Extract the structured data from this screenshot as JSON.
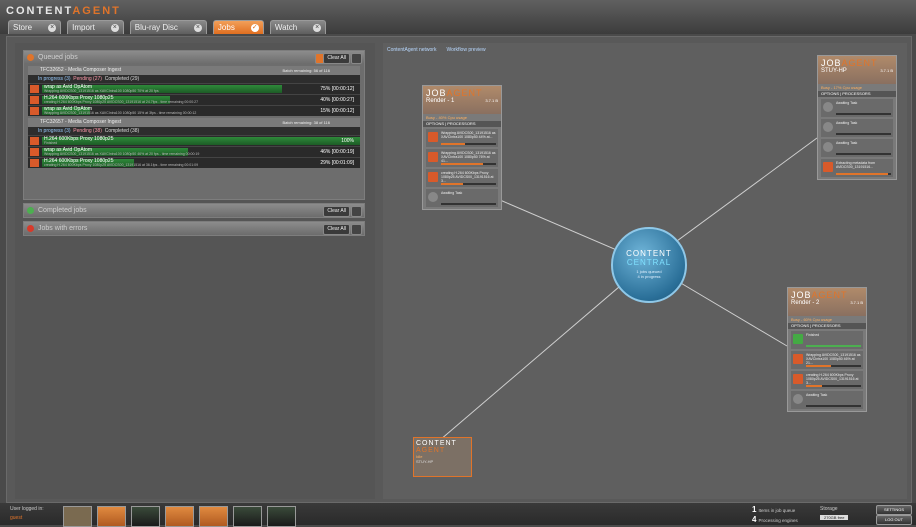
{
  "app": {
    "logo_white": "CONTENT",
    "logo_orange": "AGENT"
  },
  "tabs": [
    {
      "label": "Store"
    },
    {
      "label": "Import"
    },
    {
      "label": "Blu-ray Disc"
    },
    {
      "label": "Jobs"
    },
    {
      "label": "Watch"
    }
  ],
  "queued": {
    "title": "Queued jobs",
    "clear_label": "Clear All",
    "groups": [
      {
        "title": "TFC32652 - Media Composer Ingest",
        "sub": "Submitted by ContentAgent 'STUY-HP' at 14:49:46 on 17/05/2018",
        "remaining": "Batch remaining: 56 of 116",
        "in_progress": "In progress (3)",
        "pending": "Pending (27)",
        "completed": "Completed (29)",
        "rows": [
          {
            "title": "wrap as Avid OpAtom",
            "detail": "Wrapping AVIDCS00_13191516 as XAVCIntra100 1080p50 70% at 20 fps",
            "pct": "75% [00:00:12]",
            "progress": 0.75
          },
          {
            "title": "H.264 600Kbps Proxy 1080p25",
            "detail": "creating H.264 600Kbps Proxy 1080p25 AVIDCS00_13191516 at 24.7fps - time remaining 00:00:27",
            "pct": "40% [00:00:27]",
            "progress": 0.4
          },
          {
            "title": "wrap as Avid OpAtom",
            "detail": "Wrapping AVIDCS00_13191516 as XAVCIntra100 1080p50 15% at 3fps - time remaining 00:00:12",
            "pct": "15% [00:00:12]",
            "progress": 0.15
          }
        ]
      },
      {
        "title": "TFC32657 - Media Composer Ingest",
        "sub": "Submitted by ContentAgent 'STUY-HP' at 15:49:53 on 17/05/2018",
        "remaining": "Batch remaining: 38 of 116",
        "in_progress": "In progress (3)",
        "pending": "Pending (38)",
        "completed": "Completed (38)",
        "rows": [
          {
            "title": "H.264 600Kbps Proxy 1080p25",
            "detail": "Finished",
            "pct": "100%",
            "progress": 1.0
          },
          {
            "title": "wrap as Avid OpAtom",
            "detail": "Wrapping AVIDCS00_13191516 as XAVCIntra100 1080p50 46% at 20 fps - time remaining 00:00:19",
            "pct": "46% [00:00:19]",
            "progress": 0.46
          },
          {
            "title": "H.264 600Kbps Proxy 1080p25",
            "detail": "creating H.264 600Kbps Proxy 1080p25 AVIDCS00_13191516 at 36.1fps - time remaining 00:01:09",
            "pct": "29% [00:01:09]",
            "progress": 0.29
          }
        ]
      }
    ]
  },
  "completed_jobs": {
    "title": "Completed jobs",
    "clear_label": "Clear All"
  },
  "errored_jobs": {
    "title": "Jobs with errors",
    "clear_label": "Clear All"
  },
  "network": {
    "tab1": "ContentAgent network",
    "tab2": "Workflow preview"
  },
  "agents": [
    {
      "name": "Render - 1",
      "version": "3.7.1 B",
      "status": "Busy - 40% Cpu usage",
      "priority": "Priority",
      "processors_label": "OPTIONS | PROCESSORS",
      "slots": [
        {
          "text": "Wrapping AVIDCS00_13191516 as XAVCIntra100 1080p50 44% at...",
          "progress": 0.44
        },
        {
          "text": "Wrapping AVIDCS00_13191516 as XAVCIntra100 1080p50 76% at 41...",
          "progress": 0.76
        },
        {
          "text": "creating H.264 600Kbps Proxy 1080p25 AVIDCS00_13191516 at 3...",
          "progress": 0.4
        },
        {
          "text": "Awaiting Task",
          "progress": 0
        }
      ]
    },
    {
      "name": "STUY-HP",
      "version": "3.7.1 B",
      "status": "Busy - 17% Cpu usage",
      "priority": "Priority",
      "processors_label": "OPTIONS | PROCESSORS",
      "slots": [
        {
          "text": "Awaiting Task",
          "progress": 0
        },
        {
          "text": "Awaiting Task",
          "progress": 0
        },
        {
          "text": "Awaiting Task",
          "progress": 0
        },
        {
          "text": "Extracting metadata from AVIDCS00_13191516...",
          "progress": 0.95
        }
      ]
    },
    {
      "name": "Render - 2",
      "version": "3.7.1 B",
      "status": "Busy - 60% Cpu usage",
      "priority": "Priority",
      "processors_label": "OPTIONS | PROCESSORS",
      "slots": [
        {
          "text": "Finished",
          "progress": 1.0
        },
        {
          "text": "Wrapping AVIDCS00_13191516 as XAVCIntra100 1080p50 46% at 21...",
          "progress": 0.46
        },
        {
          "text": "creating H.264 600Kbps Proxy 1080p25 AVIDCS00_13191516 at 3...",
          "progress": 0.29
        },
        {
          "text": "Awaiting Task",
          "progress": 0
        }
      ]
    }
  ],
  "central": {
    "line1": "CONTENT",
    "line2": "CENTRAL",
    "line3": "1 jobs queued",
    "line4": "4 in progress"
  },
  "contentagent_node": {
    "l1": "CONTENT",
    "l2": "AGENT",
    "status": "Idle",
    "name": "STUY-HP"
  },
  "bottom": {
    "user_label": "User logged in:",
    "user_name": "guest",
    "queue_count": "1",
    "queue_label": "Items in job queue",
    "proc_count": "4",
    "proc_label": "Processing engines",
    "storage_label": "Storage",
    "storage_value": "270GB free",
    "settings": "SETTINGS",
    "logout": "LOG OUT"
  }
}
